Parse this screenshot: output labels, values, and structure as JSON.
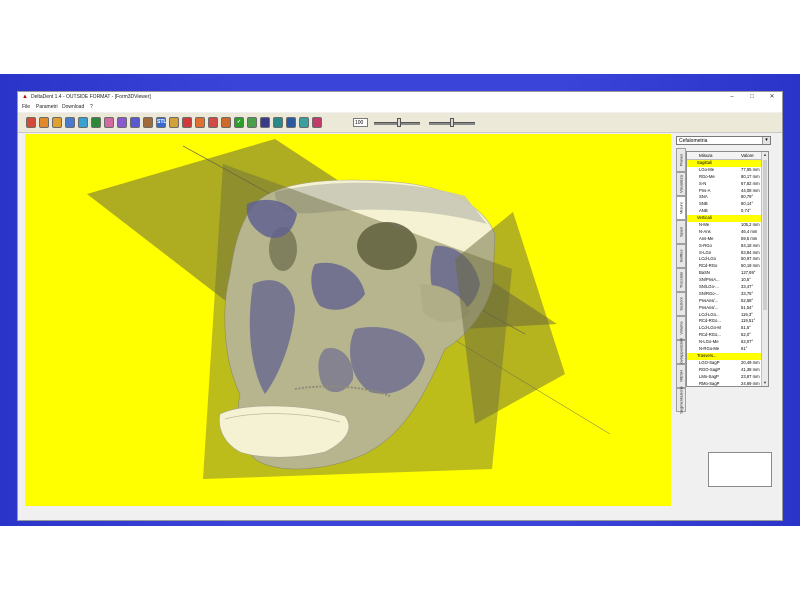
{
  "window": {
    "title": "DeltaDent 1.4 - OUTSIDE FORMAT - [Form3DViewer]",
    "controls": {
      "minimize": "–",
      "maximize": "□",
      "close": "✕"
    }
  },
  "menu": [
    "File",
    "Parametri",
    "Download",
    "?"
  ],
  "toolbar": {
    "tools": [
      {
        "icon": "palette-icon",
        "color": "#d24a3a",
        "glyph": ""
      },
      {
        "icon": "zoom-icon",
        "color": "#e08a2a",
        "glyph": ""
      },
      {
        "icon": "zoom-in-icon",
        "color": "#e0a030",
        "glyph": ""
      },
      {
        "icon": "zoom-out-icon",
        "color": "#4a7ad0",
        "glyph": ""
      },
      {
        "icon": "pan-icon",
        "color": "#3aa0d0",
        "glyph": ""
      },
      {
        "icon": "rotate-icon",
        "color": "#2a8a3a",
        "glyph": ""
      },
      {
        "icon": "head-front-icon",
        "color": "#d06aa0",
        "glyph": ""
      },
      {
        "icon": "head-side-icon",
        "color": "#8a5ad0",
        "glyph": ""
      },
      {
        "icon": "head-top-icon",
        "color": "#5a5ad0",
        "glyph": ""
      },
      {
        "icon": "skull-icon",
        "color": "#a06a3a",
        "glyph": ""
      },
      {
        "icon": "stl-icon",
        "color": "#3a6ad0",
        "glyph": "STL"
      },
      {
        "icon": "ruler-icon",
        "color": "#d0a03a",
        "glyph": ""
      },
      {
        "icon": "brush-icon",
        "color": "#d03a3a",
        "glyph": ""
      },
      {
        "icon": "tooth-icon",
        "color": "#e07030",
        "glyph": ""
      },
      {
        "icon": "jaw-icon",
        "color": "#d04a4a",
        "glyph": ""
      },
      {
        "icon": "measure-icon",
        "color": "#d06a2a",
        "glyph": ""
      },
      {
        "icon": "check-icon",
        "color": "#2aa02a",
        "glyph": "✓"
      },
      {
        "icon": "plane-icon",
        "color": "#4aa04a",
        "glyph": ""
      },
      {
        "icon": "print-icon",
        "color": "#3a3a8a",
        "glyph": ""
      },
      {
        "icon": "print-preview-icon",
        "color": "#2a8a8a",
        "glyph": ""
      },
      {
        "icon": "save-icon",
        "color": "#2a5aa0",
        "glyph": ""
      },
      {
        "icon": "export-icon",
        "color": "#3aa0a0",
        "glyph": ""
      },
      {
        "icon": "image-icon",
        "color": "#c03a6a",
        "glyph": ""
      }
    ],
    "zoom_value": "100",
    "slider1_value": 0.55,
    "slider2_value": 0.5
  },
  "panel": {
    "combo_value": "Cefalometria",
    "tabs": [
      "Planes",
      "Visualizza",
      "Misure",
      "Spazi",
      "Selfiles",
      "Tracciato",
      "Sezioni",
      "Volume",
      "Sovrapposizioni",
      "MESH",
      "Segmentazione"
    ],
    "active_tab": "Misure",
    "columns": {
      "name": "Misura",
      "value": "Valore"
    },
    "rows": [
      {
        "name": "Sagittali",
        "value": "",
        "section": true
      },
      {
        "name": "LGo-Me",
        "value": "77,95 mm",
        "section": false
      },
      {
        "name": "RGo-Me",
        "value": "80,17 mm",
        "section": false
      },
      {
        "name": "S-N",
        "value": "67,82 mm",
        "section": false
      },
      {
        "name": "Pns-A",
        "value": "44,08 mm",
        "section": false
      },
      {
        "name": "SNA",
        "value": "80,79°",
        "section": false
      },
      {
        "name": "SNB",
        "value": "80,14°",
        "section": false
      },
      {
        "name": "ANB",
        "value": "0,74°",
        "section": false
      },
      {
        "name": "Verticali",
        "value": "",
        "section": true
      },
      {
        "name": "N-Me",
        "value": "105,2 mm",
        "section": false
      },
      {
        "name": "N-Ans",
        "value": "46,4 mm",
        "section": false
      },
      {
        "name": "Ans-Me",
        "value": "59,5 mm",
        "section": false
      },
      {
        "name": "S-RGo",
        "value": "84,18 mm",
        "section": false
      },
      {
        "name": "S-LGo",
        "value": "83,84 mm",
        "section": false
      },
      {
        "name": "LCd-LGo",
        "value": "50,97 mm",
        "section": false
      },
      {
        "name": "RCd-RGo",
        "value": "50,19 mm",
        "section": false
      },
      {
        "name": "BaSN",
        "value": "127,69°",
        "section": false
      },
      {
        "name": "SN/PnsA...",
        "value": "10,5°",
        "section": false
      },
      {
        "name": "SN/LGo-...",
        "value": "33,47°",
        "section": false
      },
      {
        "name": "SN/RGo-...",
        "value": "33,75°",
        "section": false
      },
      {
        "name": "PnsAns/...",
        "value": "52,58°",
        "section": false
      },
      {
        "name": "PnsAns/...",
        "value": "51,54°",
        "section": false
      },
      {
        "name": "LCd-LGo...",
        "value": "119,3°",
        "section": false
      },
      {
        "name": "RCd-RGo...",
        "value": "119,51°",
        "section": false
      },
      {
        "name": "LCd-LGo-M",
        "value": "51,5°",
        "section": false
      },
      {
        "name": "RCd-RGo...",
        "value": "52,0°",
        "section": false
      },
      {
        "name": "N-LGo-Me",
        "value": "62,07°",
        "section": false
      },
      {
        "name": "N-RGo-Me",
        "value": "61°",
        "section": false
      },
      {
        "name": "Trasvers...",
        "value": "",
        "section": true
      },
      {
        "name": "LGO-SagP",
        "value": "20,49 mm",
        "section": false
      },
      {
        "name": "RGO-SagP",
        "value": "41,38 mm",
        "section": false
      },
      {
        "name": "LMo-SagP",
        "value": "23,87 mm",
        "section": false
      },
      {
        "name": "RMo-SagP",
        "value": "24,69 mm",
        "section": false
      }
    ]
  },
  "colors": {
    "viewport_bg": "#ffff00",
    "section_highlight": "#ffff00",
    "bone": "#f4f2d2",
    "scan_blue": "#5b5bd6",
    "plane": "#6b6a3c"
  }
}
